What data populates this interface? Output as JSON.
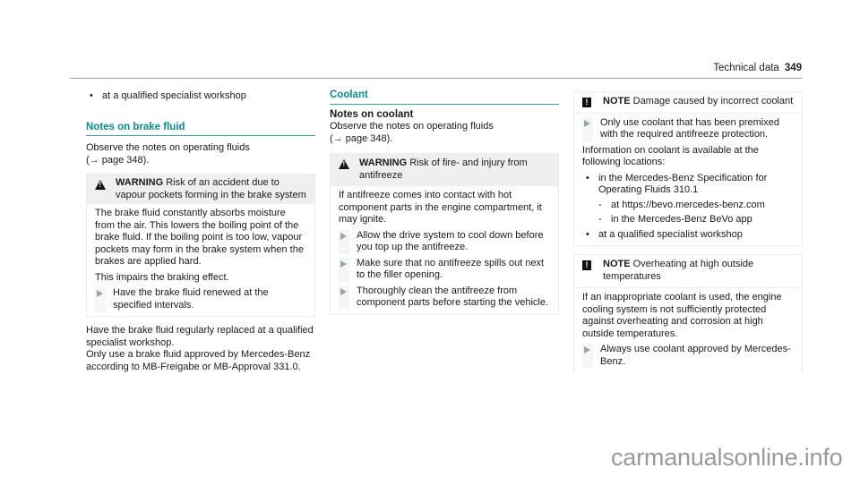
{
  "header": {
    "section": "Technical data",
    "page": "349"
  },
  "col1": {
    "top_bullet": "at a qualified specialist workshop",
    "heading": "Notes on brake fluid",
    "observe_lines": [
      "Observe the notes on operating fluids",
      "(→ page 348)."
    ],
    "warning": {
      "keyword": "WARNING",
      "title": "Risk of an accident due to vapour pockets forming in the brake system",
      "body1": "The brake fluid constantly absorbs moisture from the air. This lowers the boiling point of the brake fluid. If the boiling point is too low, vapour pockets may form in the brake system when the brakes are applied hard.",
      "body2": "This impairs the braking effect.",
      "step": "Have the brake fluid renewed at the specified intervals."
    },
    "after": [
      "Have the brake fluid regularly replaced at a qualified specialist workshop.",
      "Only use a brake fluid approved by Mercedes-Benz according to MB-Freigabe or MB-Approval 331.0."
    ]
  },
  "col2": {
    "heading": "Coolant",
    "subheading": "Notes on coolant",
    "observe_lines": [
      "Observe the notes on operating fluids",
      "(→ page 348)."
    ],
    "warning": {
      "keyword": "WARNING",
      "title": "Risk of fire- and injury from antifreeze",
      "body": "If antifreeze comes into contact with hot component parts in the engine compartment, it may ignite.",
      "steps": [
        "Allow the drive system to cool down before you top up the antifreeze.",
        "Make sure that no antifreeze spills out next to the filler opening.",
        "Thoroughly clean the antifreeze from component parts before starting the vehicle."
      ]
    }
  },
  "col3": {
    "note1": {
      "keyword": "NOTE",
      "title": "Damage caused by incorrect coolant",
      "step": "Only use coolant that has been premixed with the required antifreeze protection.",
      "info": "Information on coolant is available at the following locations:",
      "bullet1": "in the Mercedes-Benz Specification for Operating Fluids 310.1",
      "sub1": "at https://bevo.mercedes-benz.com",
      "sub2": "in the Mercedes-Benz BeVo app",
      "bullet2": "at a qualified specialist workshop"
    },
    "note2": {
      "keyword": "NOTE",
      "title": "Overheating at high outside temperatures",
      "body": "If an inappropriate coolant is used, the engine cooling system is not sufficiently protected against overheating and corrosion at high outside temperatures.",
      "step": "Always use coolant approved by Mercedes-Benz."
    }
  },
  "watermark": "carmanualsonline.info",
  "colors": {
    "accent": "#00918f",
    "box_header": "#eeefef",
    "border": "#e9eceb"
  }
}
